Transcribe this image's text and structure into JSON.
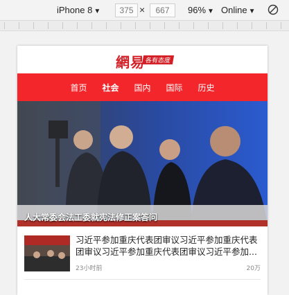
{
  "toolbar": {
    "device": "iPhone 8",
    "width": "375",
    "separator": "×",
    "height": "667",
    "zoom": "96%",
    "network": "Online",
    "caret": "▼",
    "rotate_icon": "rotate-icon"
  },
  "header": {
    "logo": "網易",
    "tagline": "各有态度"
  },
  "nav": {
    "items": [
      {
        "label": "首页"
      },
      {
        "label": "社会"
      },
      {
        "label": "国内"
      },
      {
        "label": "国际"
      },
      {
        "label": "历史"
      }
    ]
  },
  "hero": {
    "caption": "人大常委会法工委就宪法修正案答问"
  },
  "news": [
    {
      "title": "习近平参加重庆代表团审议习近平参加重庆代表团审议习近平参加重庆代表团审议习近平参加...",
      "time": "23小时前",
      "count": "20万"
    }
  ],
  "colors": {
    "brand_red": "#f2262b",
    "logo_red": "#d41f26"
  }
}
